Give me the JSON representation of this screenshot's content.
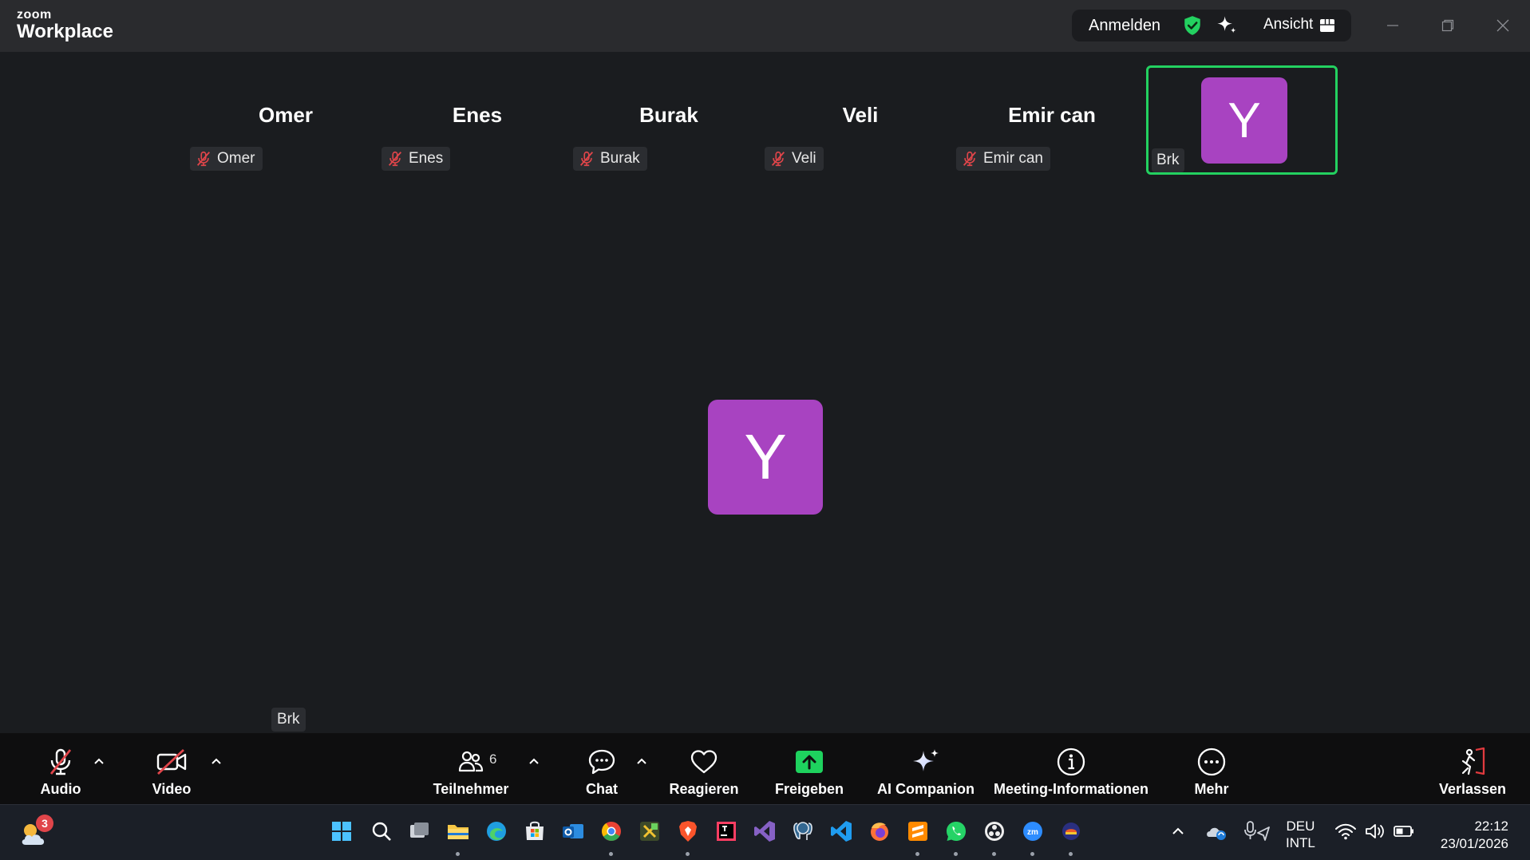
{
  "app": {
    "brand_small": "zoom",
    "brand_large": "Workplace"
  },
  "titlebar": {
    "signin_label": "Anmelden",
    "view_label": "Ansicht"
  },
  "participants": [
    {
      "name": "Omer",
      "tag": "Omer",
      "muted": true
    },
    {
      "name": "Enes",
      "tag": "Enes",
      "muted": true
    },
    {
      "name": "Burak",
      "tag": "Burak",
      "muted": true
    },
    {
      "name": "Veli",
      "tag": "Veli",
      "muted": true
    },
    {
      "name": "Emir can",
      "tag": "Emir can",
      "muted": true
    }
  ],
  "active_speaker": {
    "initial": "Y",
    "tag": "Brk"
  },
  "main_view": {
    "initial": "Y",
    "self_tag": "Brk"
  },
  "toolbar": {
    "audio_label": "Audio",
    "video_label": "Video",
    "participants_label": "Teilnehmer",
    "participants_count": "6",
    "chat_label": "Chat",
    "react_label": "Reagieren",
    "share_label": "Freigeben",
    "ai_label": "AI Companion",
    "info_label": "Meeting-Informationen",
    "more_label": "Mehr",
    "leave_label": "Verlassen"
  },
  "taskbar": {
    "weather_badge": "3",
    "lang_line1": "DEU",
    "lang_line2": "INTL",
    "time": "22:12",
    "date": "23/01/2026"
  },
  "colors": {
    "avatar": "#a843c1",
    "active_border": "#23d160",
    "share_green": "#1ed25e",
    "leave_red": "#e03a3e"
  }
}
